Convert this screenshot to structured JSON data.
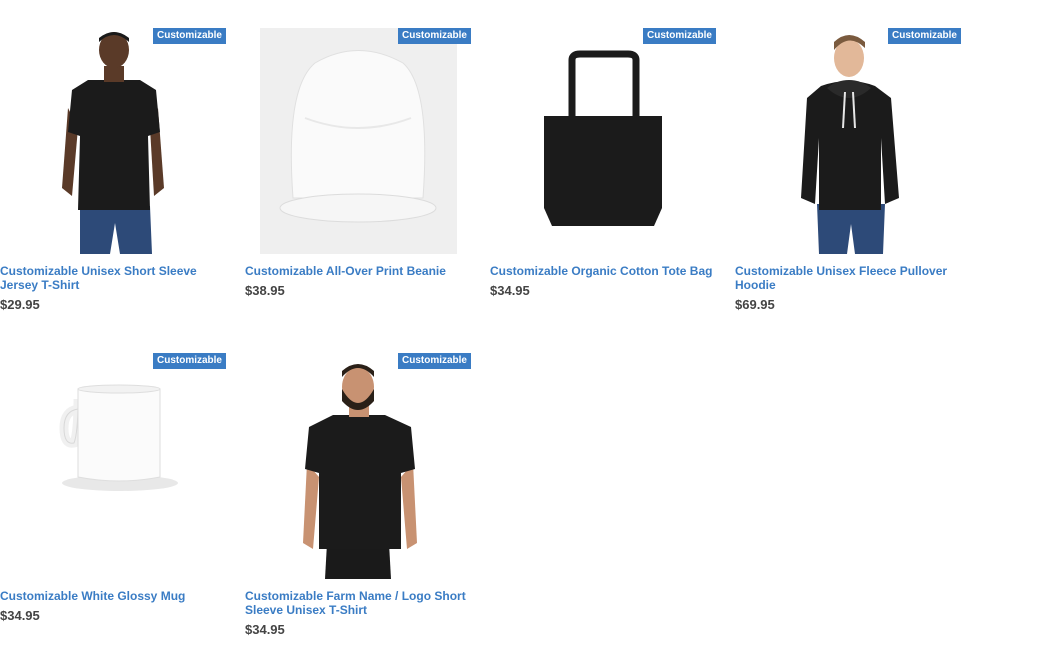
{
  "badge_label": "Customizable",
  "products": [
    {
      "title": "Customizable Unisex Short Sleeve Jersey T-Shirt",
      "price": "$29.95",
      "image": "man-black-tshirt"
    },
    {
      "title": "Customizable All-Over Print Beanie",
      "price": "$38.95",
      "image": "white-beanie"
    },
    {
      "title": "Customizable Organic Cotton Tote Bag",
      "price": "$34.95",
      "image": "black-tote-bag"
    },
    {
      "title": "Customizable Unisex Fleece Pullover Hoodie",
      "price": "$69.95",
      "image": "man-black-hoodie"
    },
    {
      "title": "Customizable White Glossy Mug",
      "price": "$34.95",
      "image": "white-mug"
    },
    {
      "title": "Customizable Farm Name / Logo Short Sleeve Unisex T-Shirt",
      "price": "$34.95",
      "image": "bearded-man-black-tshirt"
    }
  ],
  "colors": {
    "accent": "#3a7cc4",
    "price": "#444444",
    "garment": "#1b1b1b",
    "denim": "#2d4a78",
    "skin_dark": "#5a3a28",
    "skin_light": "#e2b899"
  }
}
